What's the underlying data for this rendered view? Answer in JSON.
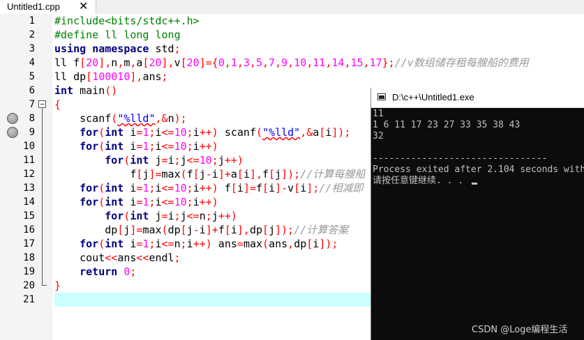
{
  "tab": {
    "title": "Untitled1.cpp",
    "close": "✕"
  },
  "line_numbers": [
    "1",
    "2",
    "3",
    "4",
    "5",
    "6",
    "7",
    "8",
    "9",
    "10",
    "11",
    "12",
    "13",
    "14",
    "15",
    "16",
    "17",
    "18",
    "19",
    "20",
    "21"
  ],
  "code": {
    "l1": [
      "#include<bits/stdc++.h>"
    ],
    "l2": [
      "#define ll long long"
    ],
    "l3": [
      "using",
      " ",
      "namespace",
      " std",
      ";"
    ],
    "l4": [
      "ll f",
      "[",
      "20",
      "],",
      "n",
      ",",
      "m",
      ",",
      "a",
      "[",
      "20",
      "],",
      "v",
      "[",
      "20",
      "]={",
      "0",
      ",",
      "1",
      ",",
      "3",
      ",",
      "5",
      ",",
      "7",
      ",",
      "9",
      ",",
      "10",
      ",",
      "11",
      ",",
      "14",
      ",",
      "15",
      ",",
      "17",
      "};",
      "//v数组储存租每艘船的费用"
    ],
    "l5": [
      "ll dp",
      "[",
      "100010",
      "],",
      "ans",
      ";"
    ],
    "l6": [
      "int",
      " main",
      "()"
    ],
    "l7": [
      "{"
    ],
    "l8": [
      "    scanf",
      "(",
      "\"%lld\"",
      ",&",
      "n",
      ");"
    ],
    "l9": [
      "    ",
      "for",
      "(",
      "int",
      " i",
      "=",
      "1",
      ";",
      "i",
      "<=",
      "10",
      ";",
      "i",
      "++)",
      " scanf",
      "(",
      "\"%lld\"",
      ",&",
      "a",
      "[",
      "i",
      "]);"
    ],
    "l10": [
      "    ",
      "for",
      "(",
      "int",
      " i",
      "=",
      "1",
      ";",
      "i",
      "<=",
      "10",
      ";",
      "i",
      "++)"
    ],
    "l11": [
      "        ",
      "for",
      "(",
      "int",
      " j",
      "=",
      "i",
      ";",
      "j",
      "<=",
      "10",
      ";",
      "j",
      "++)"
    ],
    "l12": [
      "            f",
      "[",
      "j",
      "]=",
      "max",
      "(",
      "f",
      "[",
      "j",
      "-",
      "i",
      "]+",
      "a",
      "[",
      "i",
      "],",
      "f",
      "[",
      "j",
      "]);",
      "//计算每艘船"
    ],
    "l13": [
      "    ",
      "for",
      "(",
      "int",
      " i",
      "=",
      "1",
      ";",
      "i",
      "<=",
      "10",
      ";",
      "i",
      "++)",
      " f",
      "[",
      "i",
      "]=",
      "f",
      "[",
      "i",
      "]-",
      "v",
      "[",
      "i",
      "];",
      "//相减即"
    ],
    "l14": [
      "    ",
      "for",
      "(",
      "int",
      " i",
      "=",
      "1",
      ";",
      "i",
      "<=",
      "10",
      ";",
      "i",
      "++)"
    ],
    "l15": [
      "        ",
      "for",
      "(",
      "int",
      " j",
      "=",
      "i",
      ";",
      "j",
      "<=",
      "n",
      ";",
      "j",
      "++)"
    ],
    "l16": [
      "        dp",
      "[",
      "j",
      "]=",
      "max",
      "(",
      "dp",
      "[",
      "j",
      "-",
      "i",
      "]+",
      "f",
      "[",
      "i",
      "],",
      "dp",
      "[",
      "j",
      "]);",
      "//计算答案"
    ],
    "l17": [
      "    ",
      "for",
      "(",
      "int",
      " i",
      "=",
      "1",
      ";",
      "i",
      "<=",
      "n",
      ";",
      "i",
      "++)",
      " ans",
      "=",
      "max",
      "(",
      "ans",
      ",",
      "dp",
      "[",
      "i",
      "]);"
    ],
    "l18": [
      "    cout",
      "<<",
      "ans",
      "<<",
      "endl",
      ";"
    ],
    "l19": [
      "    ",
      "return",
      " ",
      "0",
      ";"
    ],
    "l20": [
      "}"
    ]
  },
  "console": {
    "title": "D:\\c++\\Untitled1.exe",
    "lines": [
      "11",
      "1 6 11 17 23 27 33 35 38 43",
      "32",
      "",
      "--------------------------------",
      "Process exited after 2.104 seconds with",
      "请按任意键继续. . . "
    ]
  },
  "watermark": "CSDN @Loge编程生活",
  "colors": {
    "keyword": "#000080",
    "preprocessor": "#008000",
    "number": "#ff00ff",
    "string": "#0000ff",
    "symbol": "#ff0000",
    "comment": "#999999",
    "current_line": "#ccffff"
  }
}
